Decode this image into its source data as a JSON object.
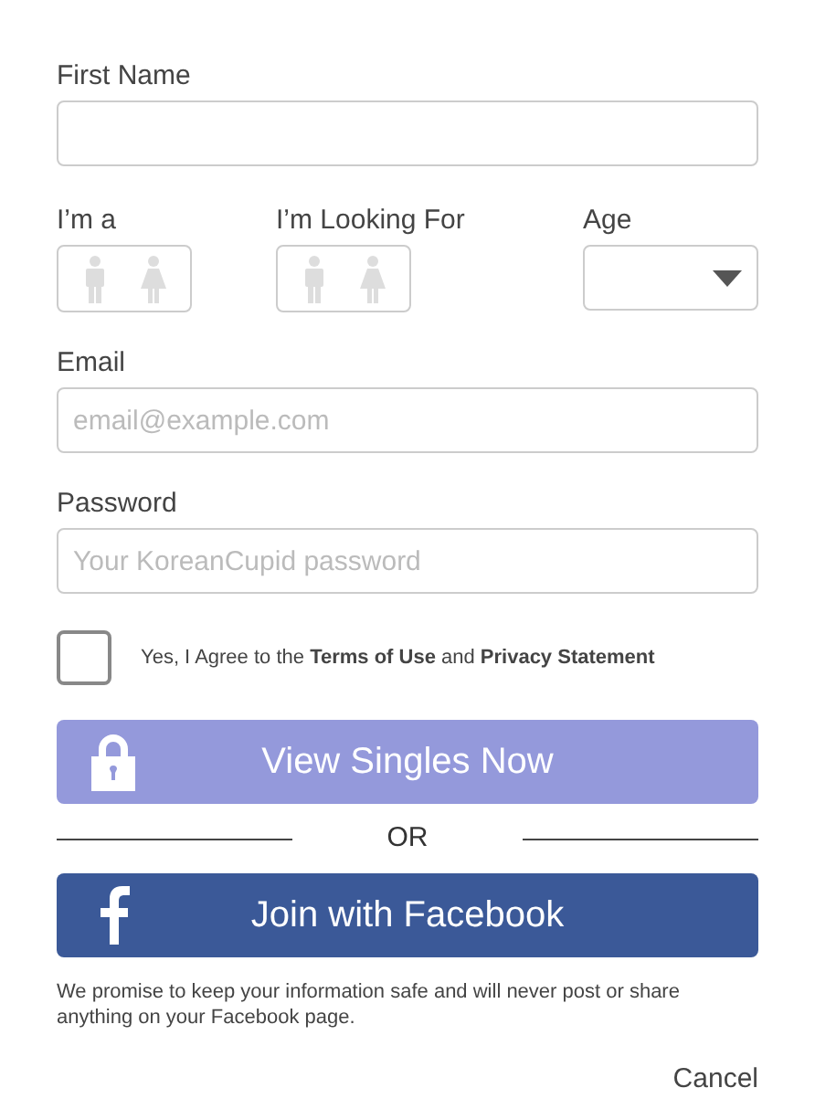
{
  "first_name": {
    "label": "First Name"
  },
  "gender_pickers": [
    {
      "label": "I’m a",
      "options": [
        {
          "kind": "male",
          "selected": false
        },
        {
          "kind": "female",
          "selected": false
        }
      ]
    },
    {
      "label": "I’m Looking For",
      "options": [
        {
          "kind": "male",
          "selected": false
        },
        {
          "kind": "female",
          "selected": false
        }
      ]
    }
  ],
  "age": {
    "label": "Age"
  },
  "email": {
    "label": "Email",
    "placeholder": "email@example.com"
  },
  "password": {
    "label": "Password",
    "placeholder": "Your KoreanCupid password"
  },
  "agree": {
    "checked": false,
    "text": "Yes, I Agree to the **Terms of Use** and **Privacy Statement**"
  },
  "submit": {
    "label": "View Singles Now",
    "disabled": true
  },
  "divider": "OR",
  "facebook": {
    "label": "Join with Facebook"
  },
  "note": "We promise to keep your information safe and will never post or share anything on your Facebook page.",
  "cancel": "Cancel"
}
